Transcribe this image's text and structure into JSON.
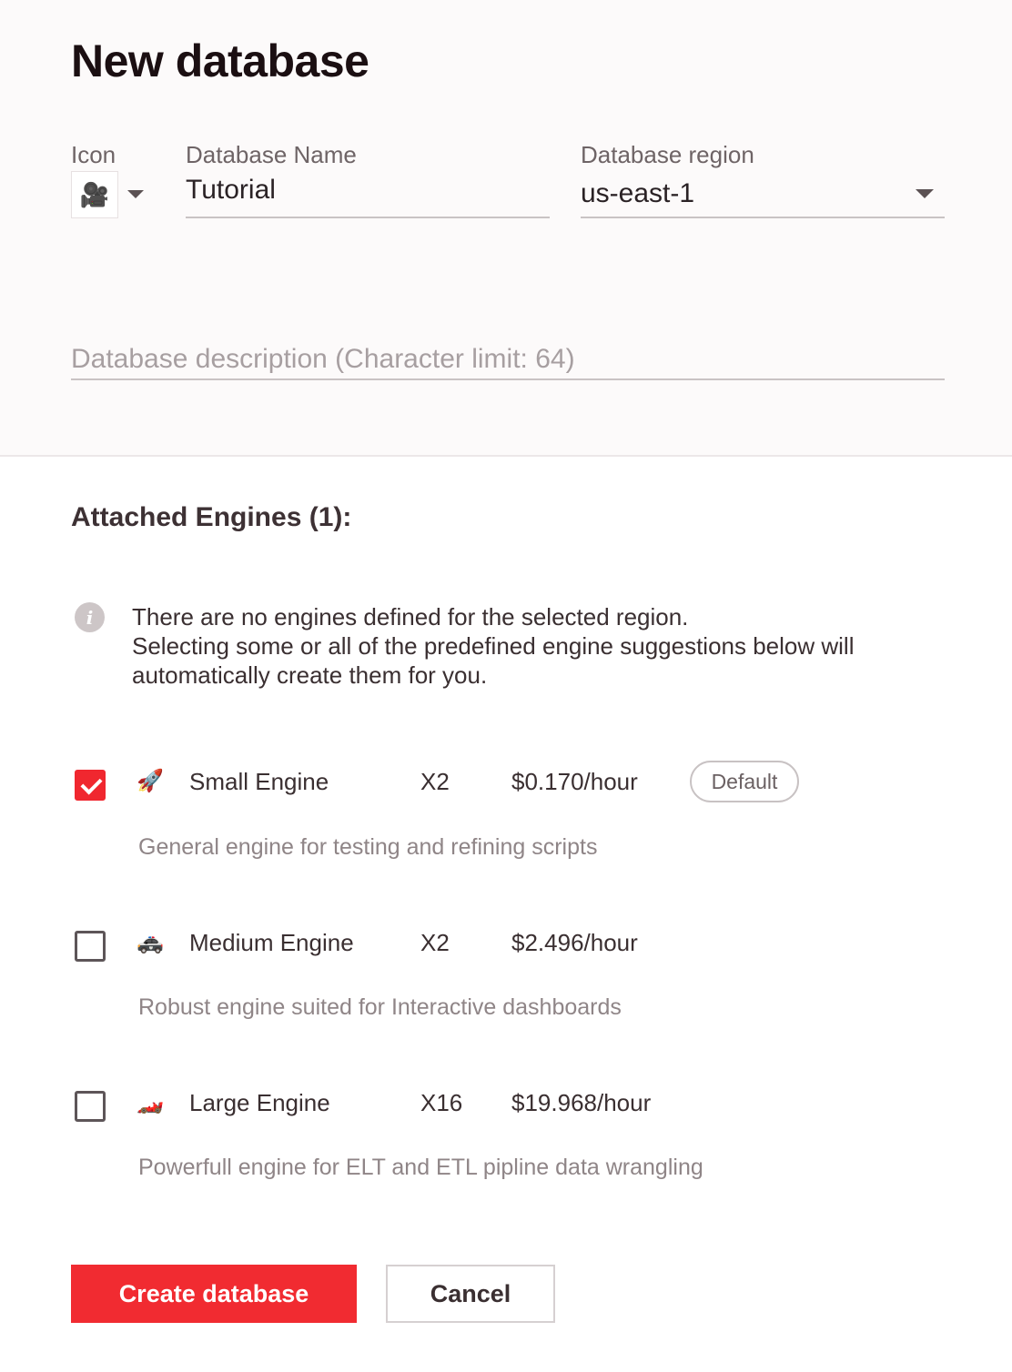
{
  "page": {
    "title": "New database"
  },
  "form": {
    "icon_label": "Icon",
    "icon_value": "🎥",
    "name_label": "Database Name",
    "name_value": "Tutorial",
    "region_label": "Database region",
    "region_value": "us-east-1",
    "description_placeholder": "Database description (Character limit: 64)"
  },
  "engines_section": {
    "title": "Attached Engines (1):",
    "info_line1": "There are no engines defined for the selected region.",
    "info_line2": "Selecting some or all of the predefined engine suggestions below will automatically create them for you."
  },
  "engines": [
    {
      "checked": true,
      "icon": "🚀",
      "name": "Small Engine",
      "multiplier": "X2",
      "price": "$0.170/hour",
      "badge": "Default",
      "description": "General engine for testing and refining scripts"
    },
    {
      "checked": false,
      "icon": "🚓",
      "name": "Medium Engine",
      "multiplier": "X2",
      "price": "$2.496/hour",
      "description": "Robust engine suited for Interactive dashboards"
    },
    {
      "checked": false,
      "icon": "🏎️",
      "name": "Large Engine",
      "multiplier": "X16",
      "price": "$19.968/hour",
      "description": "Powerfull engine for ELT and ETL pipline data wrangling"
    }
  ],
  "actions": {
    "create_label": "Create database",
    "cancel_label": "Cancel"
  },
  "colors": {
    "accent": "#f12b31",
    "title": "#1b0f12",
    "muted": "#8f8587"
  }
}
